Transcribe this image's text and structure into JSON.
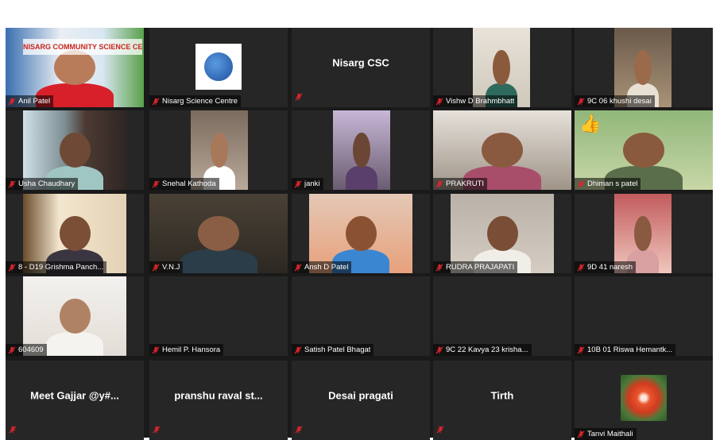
{
  "participants": [
    {
      "name": "Anil Patel",
      "mode": "video",
      "active": true
    },
    {
      "name": "Nisarg Science Centre",
      "mode": "logo"
    },
    {
      "name": "Nisarg CSC",
      "mode": "name-only"
    },
    {
      "name": "Vishw D Brahmbhatt",
      "mode": "video"
    },
    {
      "name": "9C 06 khushi desai",
      "mode": "video"
    },
    {
      "name": "Usha Chaudhary",
      "mode": "video"
    },
    {
      "name": "Snehal Kathoda",
      "mode": "video"
    },
    {
      "name": "janki",
      "mode": "video"
    },
    {
      "name": "PRAKRUTI",
      "mode": "video"
    },
    {
      "name": "Dhiman s patel",
      "mode": "video"
    },
    {
      "name": "8 - D19 Grishma Panch...",
      "mode": "video"
    },
    {
      "name": "V.N.J",
      "mode": "video"
    },
    {
      "name": "Ansh D Patel",
      "mode": "video"
    },
    {
      "name": "RUDRA PRAJAPATI",
      "mode": "video"
    },
    {
      "name": "9D 41 naresh",
      "mode": "video"
    },
    {
      "name": "604609",
      "mode": "video"
    },
    {
      "name": "Hemil P. Hansora",
      "mode": "off"
    },
    {
      "name": "Satish Patel Bhagat",
      "mode": "off"
    },
    {
      "name": "9C 22 Kavya  23 krisha...",
      "mode": "off"
    },
    {
      "name": "10B 01 Riswa Hemantk...",
      "mode": "off"
    },
    {
      "name": "Meet Gajjar @y#...",
      "mode": "name-only"
    },
    {
      "name": "pranshu raval st...",
      "mode": "name-only"
    },
    {
      "name": "Desai pragati",
      "mode": "name-only"
    },
    {
      "name": "Tirth",
      "mode": "name-only"
    },
    {
      "name": "Tanvi Maithali",
      "mode": "avatar"
    }
  ],
  "banner_text": "NISARG COMMUNITY SCIENCE CENTRE",
  "colors": {
    "active_border": "#f2cf3a",
    "mute_icon": "#e0252b",
    "tile_bg": "#262626",
    "gallery_bg": "#1a1a1a"
  }
}
